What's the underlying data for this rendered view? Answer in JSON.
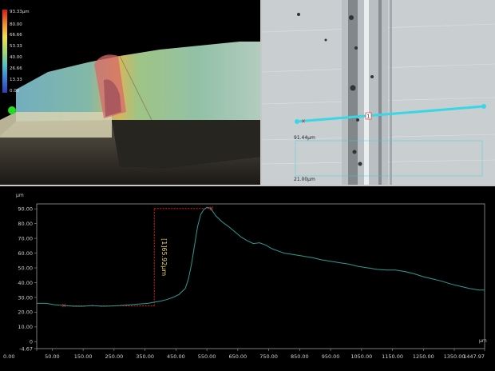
{
  "view3d": {
    "colorbar": {
      "labels": [
        "93.33μm",
        "80.00",
        "66.66",
        "53.33",
        "40.00",
        "26.66",
        "13.33",
        "0.00"
      ],
      "colors": [
        "#d7191c",
        "#f08a2c",
        "#f3e04b",
        "#a8d86a",
        "#4ec1c9",
        "#3a7fd5",
        "#2b3fb8"
      ]
    },
    "marker_color": "#22dd22"
  },
  "camera": {
    "width_label": "91.44μm",
    "depth_label": "21.00μm",
    "line_color": "#37d7e6",
    "point_label": "1"
  },
  "profile": {
    "y_unit": "μm",
    "x_unit": "μm",
    "measurement_label": "[1]65.92μm",
    "line_color": "#2e9c8f",
    "marker_color": "#e01c1c",
    "measure_text_color": "#e9d44a"
  },
  "chart_data": {
    "type": "line",
    "ylim": [
      -4.67,
      93.33
    ],
    "xlim": [
      0,
      1447.97
    ],
    "y_ticks": [
      "90.00",
      "80.00",
      "70.00",
      "60.00",
      "50.00",
      "40.00",
      "30.00",
      "20.00",
      "10.00",
      "0",
      "-4.67"
    ],
    "x_ticks": [
      "0.00",
      "50.00",
      "150.00",
      "250.00",
      "350.00",
      "450.00",
      "550.00",
      "650.00",
      "750.00",
      "850.00",
      "950.00",
      "1050.00",
      "1150.00",
      "1250.00",
      "1350.00",
      "1447.97"
    ],
    "series": [
      {
        "x": [
          0,
          30,
          60,
          90,
          120,
          150,
          180,
          210,
          240,
          270,
          300,
          330,
          360,
          380,
          400,
          420,
          440,
          460,
          480,
          490,
          500,
          510,
          520,
          530,
          540,
          550,
          560,
          570,
          580,
          600,
          620,
          640,
          660,
          680,
          700,
          720,
          740,
          760,
          780,
          800,
          830,
          860,
          890,
          920,
          950,
          980,
          1010,
          1040,
          1070,
          1100,
          1130,
          1160,
          1190,
          1220,
          1250,
          1280,
          1310,
          1340,
          1370,
          1400,
          1430,
          1447.97
        ],
        "y": [
          26.0,
          26.0,
          25.0,
          24.5,
          24.0,
          24.0,
          24.5,
          24.0,
          24.2,
          24.5,
          25.0,
          25.5,
          26.0,
          26.8,
          27.5,
          28.5,
          30.0,
          32.0,
          36.0,
          42.0,
          52.0,
          65.0,
          78.0,
          86.0,
          89.5,
          91.0,
          90.5,
          88.0,
          85.0,
          81.0,
          78.0,
          74.5,
          71.0,
          68.5,
          66.5,
          67.0,
          65.5,
          63.0,
          61.5,
          60.0,
          59.0,
          58.0,
          57.0,
          55.5,
          54.5,
          53.5,
          52.5,
          51.0,
          50.0,
          49.0,
          48.5,
          48.5,
          47.5,
          46.0,
          44.0,
          42.5,
          41.0,
          39.0,
          37.5,
          36.0,
          35.0,
          35.0
        ]
      }
    ],
    "measurement": {
      "x1": 88,
      "y1": 24.3,
      "x2": 380,
      "y2": 24.3,
      "x3": 380,
      "y3": 90.2,
      "x4": 565,
      "y4": 90.2
    },
    "grid": false,
    "title": "",
    "xlabel": "",
    "ylabel": ""
  }
}
